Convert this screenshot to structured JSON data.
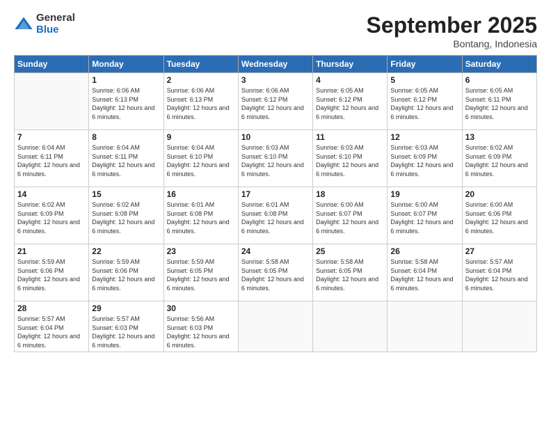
{
  "logo": {
    "general": "General",
    "blue": "Blue"
  },
  "title": "September 2025",
  "location": "Bontang, Indonesia",
  "days_of_week": [
    "Sunday",
    "Monday",
    "Tuesday",
    "Wednesday",
    "Thursday",
    "Friday",
    "Saturday"
  ],
  "weeks": [
    [
      {
        "day": "",
        "sunrise": "",
        "sunset": "",
        "daylight": "",
        "empty": true
      },
      {
        "day": "1",
        "sunrise": "Sunrise: 6:06 AM",
        "sunset": "Sunset: 6:13 PM",
        "daylight": "Daylight: 12 hours and 6 minutes.",
        "empty": false
      },
      {
        "day": "2",
        "sunrise": "Sunrise: 6:06 AM",
        "sunset": "Sunset: 6:13 PM",
        "daylight": "Daylight: 12 hours and 6 minutes.",
        "empty": false
      },
      {
        "day": "3",
        "sunrise": "Sunrise: 6:06 AM",
        "sunset": "Sunset: 6:12 PM",
        "daylight": "Daylight: 12 hours and 6 minutes.",
        "empty": false
      },
      {
        "day": "4",
        "sunrise": "Sunrise: 6:05 AM",
        "sunset": "Sunset: 6:12 PM",
        "daylight": "Daylight: 12 hours and 6 minutes.",
        "empty": false
      },
      {
        "day": "5",
        "sunrise": "Sunrise: 6:05 AM",
        "sunset": "Sunset: 6:12 PM",
        "daylight": "Daylight: 12 hours and 6 minutes.",
        "empty": false
      },
      {
        "day": "6",
        "sunrise": "Sunrise: 6:05 AM",
        "sunset": "Sunset: 6:11 PM",
        "daylight": "Daylight: 12 hours and 6 minutes.",
        "empty": false
      }
    ],
    [
      {
        "day": "7",
        "sunrise": "Sunrise: 6:04 AM",
        "sunset": "Sunset: 6:11 PM",
        "daylight": "Daylight: 12 hours and 6 minutes.",
        "empty": false
      },
      {
        "day": "8",
        "sunrise": "Sunrise: 6:04 AM",
        "sunset": "Sunset: 6:11 PM",
        "daylight": "Daylight: 12 hours and 6 minutes.",
        "empty": false
      },
      {
        "day": "9",
        "sunrise": "Sunrise: 6:04 AM",
        "sunset": "Sunset: 6:10 PM",
        "daylight": "Daylight: 12 hours and 6 minutes.",
        "empty": false
      },
      {
        "day": "10",
        "sunrise": "Sunrise: 6:03 AM",
        "sunset": "Sunset: 6:10 PM",
        "daylight": "Daylight: 12 hours and 6 minutes.",
        "empty": false
      },
      {
        "day": "11",
        "sunrise": "Sunrise: 6:03 AM",
        "sunset": "Sunset: 6:10 PM",
        "daylight": "Daylight: 12 hours and 6 minutes.",
        "empty": false
      },
      {
        "day": "12",
        "sunrise": "Sunrise: 6:03 AM",
        "sunset": "Sunset: 6:09 PM",
        "daylight": "Daylight: 12 hours and 6 minutes.",
        "empty": false
      },
      {
        "day": "13",
        "sunrise": "Sunrise: 6:02 AM",
        "sunset": "Sunset: 6:09 PM",
        "daylight": "Daylight: 12 hours and 6 minutes.",
        "empty": false
      }
    ],
    [
      {
        "day": "14",
        "sunrise": "Sunrise: 6:02 AM",
        "sunset": "Sunset: 6:09 PM",
        "daylight": "Daylight: 12 hours and 6 minutes.",
        "empty": false
      },
      {
        "day": "15",
        "sunrise": "Sunrise: 6:02 AM",
        "sunset": "Sunset: 6:08 PM",
        "daylight": "Daylight: 12 hours and 6 minutes.",
        "empty": false
      },
      {
        "day": "16",
        "sunrise": "Sunrise: 6:01 AM",
        "sunset": "Sunset: 6:08 PM",
        "daylight": "Daylight: 12 hours and 6 minutes.",
        "empty": false
      },
      {
        "day": "17",
        "sunrise": "Sunrise: 6:01 AM",
        "sunset": "Sunset: 6:08 PM",
        "daylight": "Daylight: 12 hours and 6 minutes.",
        "empty": false
      },
      {
        "day": "18",
        "sunrise": "Sunrise: 6:00 AM",
        "sunset": "Sunset: 6:07 PM",
        "daylight": "Daylight: 12 hours and 6 minutes.",
        "empty": false
      },
      {
        "day": "19",
        "sunrise": "Sunrise: 6:00 AM",
        "sunset": "Sunset: 6:07 PM",
        "daylight": "Daylight: 12 hours and 6 minutes.",
        "empty": false
      },
      {
        "day": "20",
        "sunrise": "Sunrise: 6:00 AM",
        "sunset": "Sunset: 6:06 PM",
        "daylight": "Daylight: 12 hours and 6 minutes.",
        "empty": false
      }
    ],
    [
      {
        "day": "21",
        "sunrise": "Sunrise: 5:59 AM",
        "sunset": "Sunset: 6:06 PM",
        "daylight": "Daylight: 12 hours and 6 minutes.",
        "empty": false
      },
      {
        "day": "22",
        "sunrise": "Sunrise: 5:59 AM",
        "sunset": "Sunset: 6:06 PM",
        "daylight": "Daylight: 12 hours and 6 minutes.",
        "empty": false
      },
      {
        "day": "23",
        "sunrise": "Sunrise: 5:59 AM",
        "sunset": "Sunset: 6:05 PM",
        "daylight": "Daylight: 12 hours and 6 minutes.",
        "empty": false
      },
      {
        "day": "24",
        "sunrise": "Sunrise: 5:58 AM",
        "sunset": "Sunset: 6:05 PM",
        "daylight": "Daylight: 12 hours and 6 minutes.",
        "empty": false
      },
      {
        "day": "25",
        "sunrise": "Sunrise: 5:58 AM",
        "sunset": "Sunset: 6:05 PM",
        "daylight": "Daylight: 12 hours and 6 minutes.",
        "empty": false
      },
      {
        "day": "26",
        "sunrise": "Sunrise: 5:58 AM",
        "sunset": "Sunset: 6:04 PM",
        "daylight": "Daylight: 12 hours and 6 minutes.",
        "empty": false
      },
      {
        "day": "27",
        "sunrise": "Sunrise: 5:57 AM",
        "sunset": "Sunset: 6:04 PM",
        "daylight": "Daylight: 12 hours and 6 minutes.",
        "empty": false
      }
    ],
    [
      {
        "day": "28",
        "sunrise": "Sunrise: 5:57 AM",
        "sunset": "Sunset: 6:04 PM",
        "daylight": "Daylight: 12 hours and 6 minutes.",
        "empty": false
      },
      {
        "day": "29",
        "sunrise": "Sunrise: 5:57 AM",
        "sunset": "Sunset: 6:03 PM",
        "daylight": "Daylight: 12 hours and 6 minutes.",
        "empty": false
      },
      {
        "day": "30",
        "sunrise": "Sunrise: 5:56 AM",
        "sunset": "Sunset: 6:03 PM",
        "daylight": "Daylight: 12 hours and 6 minutes.",
        "empty": false
      },
      {
        "day": "",
        "sunrise": "",
        "sunset": "",
        "daylight": "",
        "empty": true
      },
      {
        "day": "",
        "sunrise": "",
        "sunset": "",
        "daylight": "",
        "empty": true
      },
      {
        "day": "",
        "sunrise": "",
        "sunset": "",
        "daylight": "",
        "empty": true
      },
      {
        "day": "",
        "sunrise": "",
        "sunset": "",
        "daylight": "",
        "empty": true
      }
    ]
  ]
}
